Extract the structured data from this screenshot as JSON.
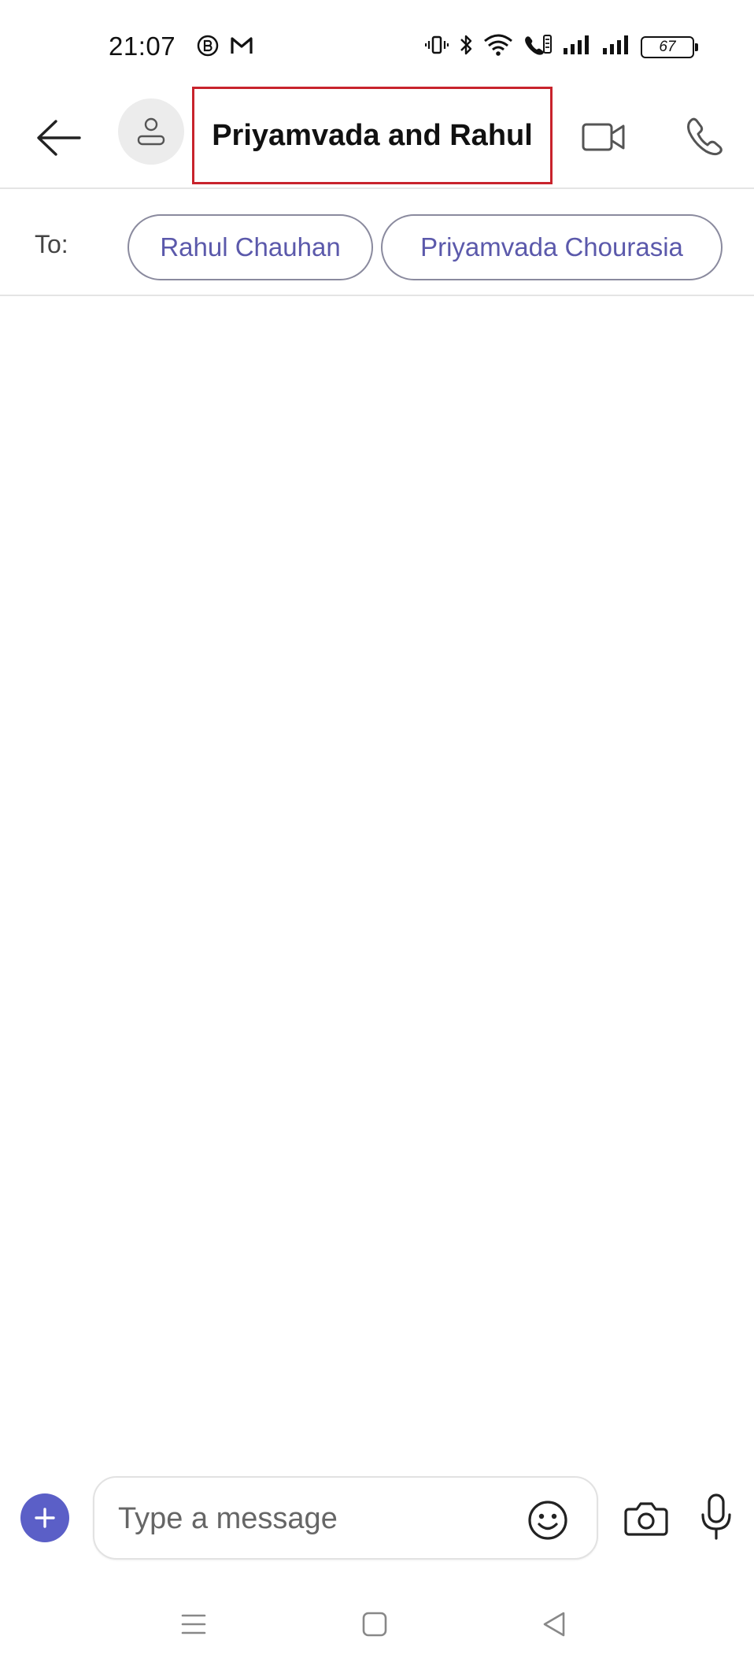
{
  "status_bar": {
    "time": "21:07",
    "left_icons": [
      "b-notification-icon",
      "gmail-icon"
    ],
    "right_icons": [
      "vibrate-icon",
      "bluetooth-icon",
      "wifi-icon",
      "volte-call-icon",
      "signal-icon",
      "signal-icon"
    ],
    "battery": "67"
  },
  "header": {
    "title": "Priyamvada and Rahul",
    "back_icon": "arrow-left-icon",
    "avatar_icon": "person-icon",
    "video_icon": "video-camera-icon",
    "call_icon": "phone-icon",
    "highlight_color": "#c8232c"
  },
  "recipients": {
    "label": "To:",
    "chips": [
      "Rahul Chauhan",
      "Priyamvada Chourasia"
    ],
    "chip_text_color": "#5b59ab"
  },
  "composer": {
    "placeholder": "Type a message",
    "plus_icon": "plus-icon",
    "emoji_icon": "smiley-icon",
    "camera_icon": "camera-icon",
    "mic_icon": "microphone-icon",
    "accent_color": "#5b5fc7"
  },
  "nav_bar": {
    "icons": [
      "menu-icon",
      "home-square-icon",
      "back-triangle-icon"
    ]
  }
}
